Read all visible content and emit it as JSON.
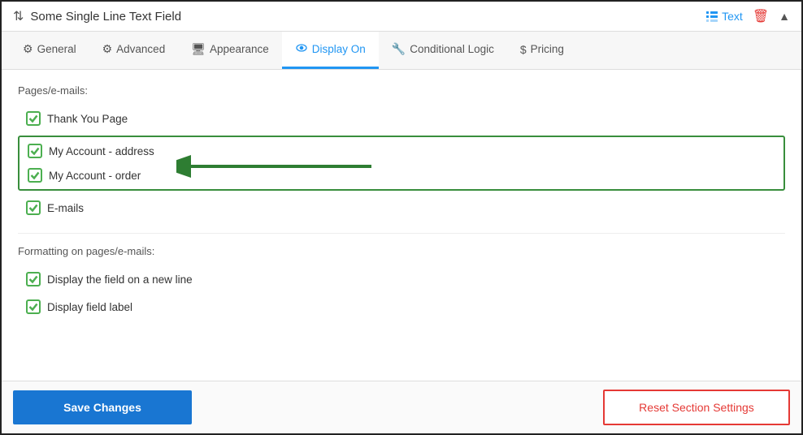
{
  "header": {
    "title": "Some Single Line Text Field",
    "text_label": "Text"
  },
  "tabs": [
    {
      "id": "general",
      "label": "General",
      "icon": "⚙"
    },
    {
      "id": "advanced",
      "label": "Advanced",
      "icon": "⚙"
    },
    {
      "id": "appearance",
      "label": "Appearance",
      "icon": "🖥"
    },
    {
      "id": "display_on",
      "label": "Display On",
      "icon": "👁",
      "active": true
    },
    {
      "id": "conditional_logic",
      "label": "Conditional Logic",
      "icon": "🔧"
    },
    {
      "id": "pricing",
      "label": "Pricing",
      "icon": "$"
    }
  ],
  "content": {
    "pages_emails_label": "Pages/e-mails:",
    "items": [
      {
        "id": "thank_you",
        "label": "Thank You Page",
        "checked": true,
        "grouped": false
      },
      {
        "id": "my_account_address",
        "label": "My Account - address",
        "checked": true,
        "grouped": true
      },
      {
        "id": "my_account_order",
        "label": "My Account - order",
        "checked": true,
        "grouped": true
      },
      {
        "id": "emails",
        "label": "E-mails",
        "checked": true,
        "grouped": false
      }
    ],
    "formatting_label": "Formatting on pages/e-mails:",
    "formatting_items": [
      {
        "id": "new_line",
        "label": "Display the field on a new line",
        "checked": true
      },
      {
        "id": "field_label",
        "label": "Display field label",
        "checked": true
      }
    ]
  },
  "footer": {
    "save_label": "Save Changes",
    "reset_label": "Reset Section Settings"
  }
}
